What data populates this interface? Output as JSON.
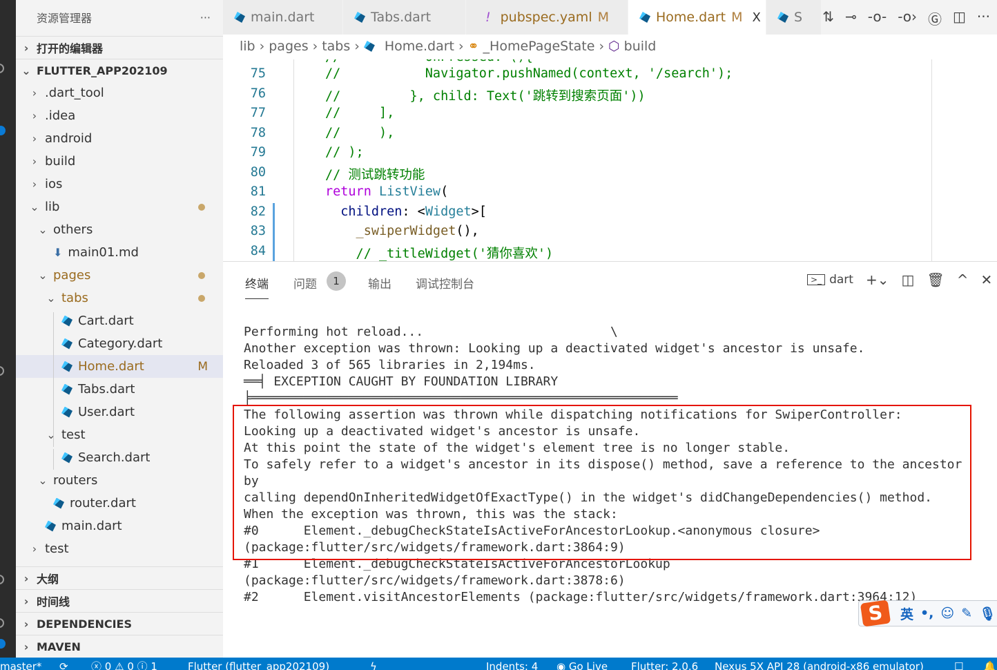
{
  "sidebar": {
    "title": "资源管理器",
    "more": "···",
    "rows": [
      {
        "label": "打开的编辑器",
        "type": "section",
        "chev": "›"
      },
      {
        "label": "FLUTTER_APP202109",
        "type": "section",
        "chev": "⌄"
      },
      {
        "label": ".dart_tool",
        "indent": 1,
        "chev": "›"
      },
      {
        "label": ".idea",
        "indent": 1,
        "chev": "›"
      },
      {
        "label": "android",
        "indent": 1,
        "chev": "›"
      },
      {
        "label": "build",
        "indent": 1,
        "chev": "›"
      },
      {
        "label": "ios",
        "indent": 1,
        "chev": "›"
      },
      {
        "label": "lib",
        "indent": 1,
        "chev": "⌄",
        "dot": true
      },
      {
        "label": "others",
        "indent": 2,
        "chev": "⌄"
      },
      {
        "label": "main01.md",
        "indent": 3,
        "icon": "markdown"
      },
      {
        "label": "pages",
        "indent": 2,
        "chev": "⌄",
        "dot": true,
        "color": "#9a6b1f"
      },
      {
        "label": "tabs",
        "indent": 3,
        "chev": "⌄",
        "dot": true,
        "color": "#9a6b1f"
      },
      {
        "label": "Cart.dart",
        "indent": 4,
        "icon": "dart"
      },
      {
        "label": "Category.dart",
        "indent": 4,
        "icon": "dart"
      },
      {
        "label": "Home.dart",
        "indent": 4,
        "icon": "dart",
        "mark": "M",
        "selected": true,
        "color": "#9a6b1f"
      },
      {
        "label": "Tabs.dart",
        "indent": 4,
        "icon": "dart"
      },
      {
        "label": "User.dart",
        "indent": 4,
        "icon": "dart"
      },
      {
        "label": "test",
        "indent": 3,
        "chev": "⌄"
      },
      {
        "label": "Search.dart",
        "indent": 4,
        "icon": "dart"
      },
      {
        "label": "routers",
        "indent": 2,
        "chev": "⌄"
      },
      {
        "label": "router.dart",
        "indent": 3,
        "icon": "dart"
      },
      {
        "label": "main.dart",
        "indent": 2,
        "icon": "dart"
      },
      {
        "label": "test",
        "indent": 1,
        "chev": "›"
      },
      {
        "label": "大纲",
        "type": "section",
        "chev": "›"
      },
      {
        "label": "时间线",
        "type": "section",
        "chev": "›"
      },
      {
        "label": "DEPENDENCIES",
        "type": "section",
        "chev": "›"
      },
      {
        "label": "MAVEN",
        "type": "section",
        "chev": "›"
      }
    ]
  },
  "tabs": [
    {
      "label": "main.dart",
      "icon": "dart"
    },
    {
      "label": "Tabs.dart",
      "icon": "dart"
    },
    {
      "label": "pubspec.yaml",
      "icon": "yaml",
      "mark": "M"
    },
    {
      "label": "Home.dart",
      "icon": "dart",
      "mark": "M",
      "active": true,
      "close": "X"
    },
    {
      "label": "S",
      "icon": "dart"
    }
  ],
  "breadcrumb": [
    "lib",
    "pages",
    "tabs",
    "Home.dart",
    "_HomePageState",
    "build"
  ],
  "code": [
    {
      "n": "75",
      "t": [
        [
          "//           ",
          "cm"
        ],
        [
          "Navigator.pushNamed(context, '/search');",
          "cm"
        ]
      ]
    },
    {
      "n": "76",
      "t": [
        [
          "//         }, child: Text('跳转到搜索页面'))",
          "cm"
        ]
      ]
    },
    {
      "n": "77",
      "t": [
        [
          "//     ],",
          "cm"
        ]
      ]
    },
    {
      "n": "78",
      "t": [
        [
          "//     ),",
          "cm"
        ]
      ]
    },
    {
      "n": "79",
      "t": [
        [
          "// );",
          "cm"
        ]
      ]
    },
    {
      "n": "80",
      "t": [
        [
          "// 测试跳转功能",
          "cm"
        ]
      ]
    },
    {
      "n": "81",
      "t": [
        [
          "return ",
          "kw"
        ],
        [
          "ListView",
          "ty"
        ],
        [
          "(",
          "pl"
        ]
      ]
    },
    {
      "n": "82",
      "t": [
        [
          "  children",
          "va"
        ],
        [
          ": <",
          "pl"
        ],
        [
          "Widget",
          "ty"
        ],
        [
          ">[",
          "pl"
        ]
      ]
    },
    {
      "n": "83",
      "t": [
        [
          "    _swiperWidget",
          "fn"
        ],
        [
          "(),",
          "pl"
        ]
      ]
    },
    {
      "n": "84",
      "t": [
        [
          "    // _titleWidget('猜你喜欢')",
          "cm"
        ]
      ]
    }
  ],
  "panel": {
    "tabs": [
      "终端",
      "问题",
      "输出",
      "调试控制台"
    ],
    "problems_count": "1",
    "terminal_name": "dart"
  },
  "terminal": [
    "Performing hot reload...                         \\",
    "Another exception was thrown: Looking up a deactivated widget's ancestor is unsafe.",
    "",
    "Reloaded 3 of 565 libraries in 2,194ms.",
    "",
    "══╡ EXCEPTION CAUGHT BY FOUNDATION LIBRARY",
    "╞═════════════════════════════════════════════════════════",
    "The following assertion was thrown while dispatching notifications for SwiperController:",
    "Looking up a deactivated widget's ancestor is unsafe.",
    "At this point the state of the widget's element tree is no longer stable.",
    "To safely refer to a widget's ancestor in its dispose() method, save a reference to the ancestor",
    "by",
    "calling dependOnInheritedWidgetOfExactType() in the widget's didChangeDependencies() method.",
    "",
    "When the exception was thrown, this was the stack:",
    "#0      Element._debugCheckStateIsActiveForAncestorLookup.<anonymous closure>",
    "(package:flutter/src/widgets/framework.dart:3864:9)",
    "#1      Element._debugCheckStateIsActiveForAncestorLookup",
    "(package:flutter/src/widgets/framework.dart:3878:6)",
    "#2      Element.visitAncestorElements (package:flutter/src/widgets/framework.dart:3964:12)"
  ],
  "status": {
    "branch": "master*",
    "errors": "0",
    "warnings": "0",
    "info": "1",
    "flutter_project": "Flutter (flutter_app202109)",
    "indents": "Indents: 4",
    "golive": "Go Live",
    "flutter_version": "Flutter: 2.0.6",
    "device": "Nexus 5X API 28 (android-x86 emulator)"
  },
  "ime": {
    "lang": "英",
    "punct": "•,"
  },
  "colors": {
    "status_bar": "#007acc",
    "error_box": "#e51400",
    "modified": "#9a6b1f"
  }
}
